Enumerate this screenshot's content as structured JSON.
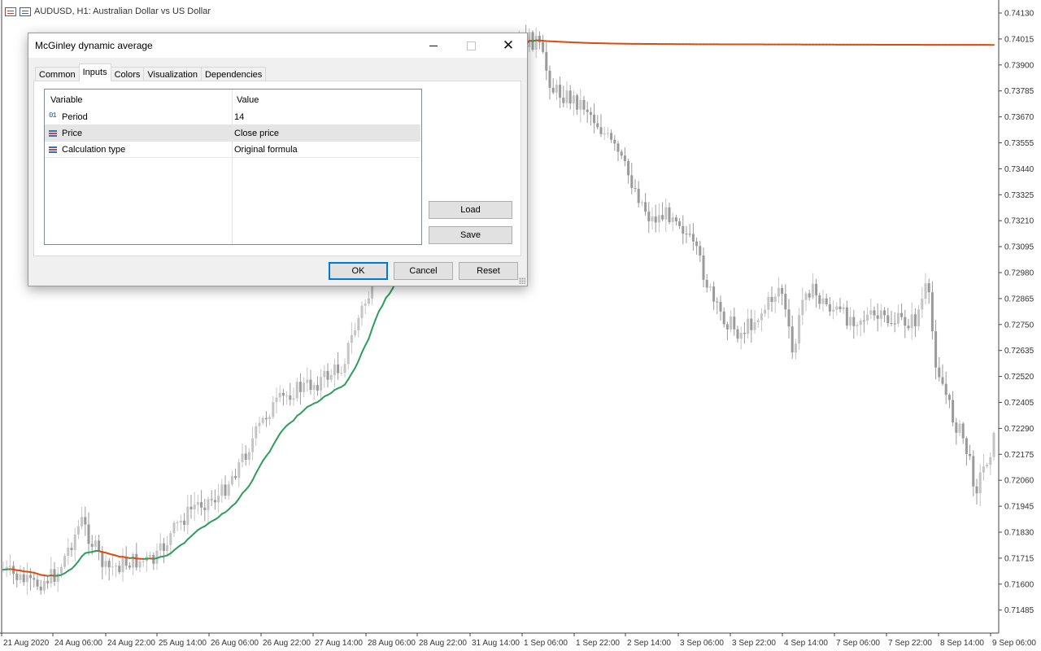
{
  "chart": {
    "symbol_title": "AUDUSD, H1:  Australian Dollar vs US Dollar",
    "price_labels": [
      "0.74130",
      "0.74015",
      "0.73900",
      "0.73785",
      "0.73670",
      "0.73555",
      "0.73440",
      "0.73325",
      "0.73210",
      "0.73095",
      "0.72980",
      "0.72865",
      "0.72750",
      "0.72635",
      "0.72520",
      "0.72405",
      "0.72290",
      "0.72175",
      "0.72060",
      "0.71945",
      "0.71830",
      "0.71715",
      "0.71600",
      "0.71485"
    ],
    "time_labels": [
      "21 Aug 2020",
      "24 Aug 06:00",
      "24 Aug 22:00",
      "25 Aug 14:00",
      "26 Aug 06:00",
      "26 Aug 22:00",
      "27 Aug 14:00",
      "28 Aug 06:00",
      "28 Aug 22:00",
      "31 Aug 14:00",
      "1 Sep 06:00",
      "1 Sep 22:00",
      "2 Sep 14:00",
      "3 Sep 06:00",
      "3 Sep 22:00",
      "4 Sep 14:00",
      "7 Sep 06:00",
      "7 Sep 22:00",
      "8 Sep 14:00",
      "9 Sep 06:00"
    ],
    "colors": {
      "candle_bull": "#c4c4c4",
      "candle_bear": "#9a9a9a",
      "ma_rising": "#2e9e5b",
      "ma_falling": "#e04a10",
      "background": "#ffffff"
    }
  },
  "dialog": {
    "title": "McGinley dynamic average",
    "tabs": [
      "Common",
      "Inputs",
      "Colors",
      "Visualization",
      "Dependencies"
    ],
    "active_tab": "Inputs",
    "grid": {
      "headers": {
        "variable": "Variable",
        "value": "Value"
      },
      "rows": [
        {
          "icon": "integer-param-icon",
          "icon_text": "01",
          "variable": "Period",
          "value": "14"
        },
        {
          "icon": "enum-param-icon",
          "variable": "Price",
          "value": "Close price"
        },
        {
          "icon": "enum-param-icon",
          "variable": "Calculation type",
          "value": "Original formula"
        }
      ]
    },
    "buttons": {
      "load": "Load",
      "save": "Save",
      "ok": "OK",
      "cancel": "Cancel",
      "reset": "Reset"
    }
  }
}
